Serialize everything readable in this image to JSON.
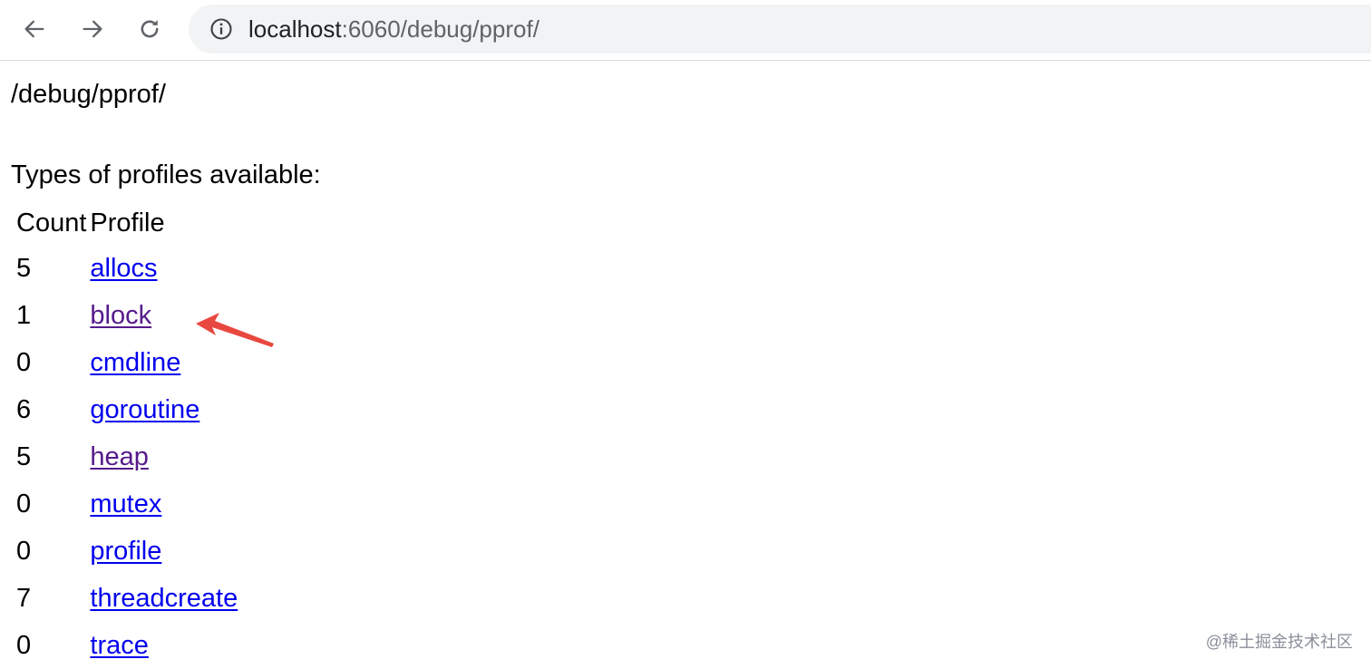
{
  "browser": {
    "back_icon": "arrow-left-icon",
    "forward_icon": "arrow-right-icon",
    "reload_icon": "reload-icon",
    "info_icon": "info-circle-icon",
    "url_host": "localhost",
    "url_path": ":6060/debug/pprof/"
  },
  "page": {
    "path": "/debug/pprof/",
    "subtitle": "Types of profiles available:",
    "table": {
      "headers": [
        "Count",
        "Profile"
      ],
      "rows": [
        {
          "count": "5",
          "profile": "allocs",
          "visited": false
        },
        {
          "count": "1",
          "profile": "block",
          "visited": true
        },
        {
          "count": "0",
          "profile": "cmdline",
          "visited": false
        },
        {
          "count": "6",
          "profile": "goroutine",
          "visited": false
        },
        {
          "count": "5",
          "profile": "heap",
          "visited": true
        },
        {
          "count": "0",
          "profile": "mutex",
          "visited": false
        },
        {
          "count": "0",
          "profile": "profile",
          "visited": false
        },
        {
          "count": "7",
          "profile": "threadcreate",
          "visited": false
        },
        {
          "count": "0",
          "profile": "trace",
          "visited": false
        }
      ]
    }
  },
  "annotation": {
    "arrow_color": "#e8483f"
  },
  "colors": {
    "link": "#0000ee",
    "visited_link": "#551a8b"
  },
  "watermark": "@稀土掘金技术社区"
}
